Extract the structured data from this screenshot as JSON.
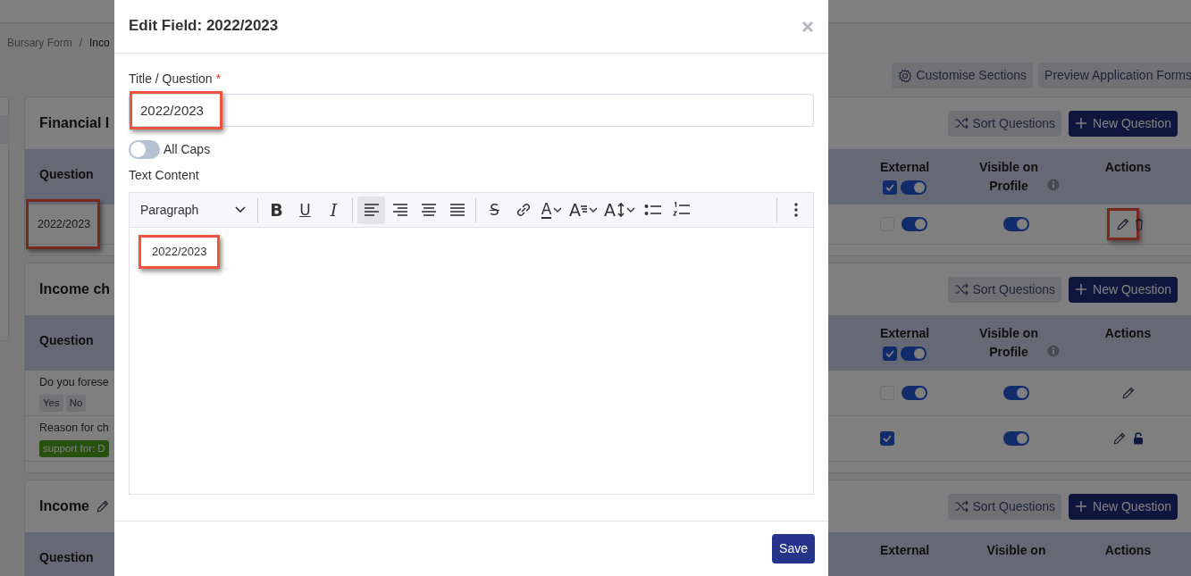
{
  "breadcrumb": {
    "separator": "/",
    "items": [
      {
        "label": "Bursary Form"
      },
      {
        "label": "Inco"
      }
    ]
  },
  "page_actions": [
    {
      "kind": "settings",
      "label": "Customise Sections"
    },
    {
      "kind": "plain",
      "label": "Preview Application Forms"
    }
  ],
  "sections": [
    {
      "title": "Financial I",
      "buttons": [
        {
          "kind": "sort",
          "label": "Sort Questions"
        },
        {
          "kind": "add",
          "label": "New Question"
        }
      ],
      "columns": [
        {
          "label": "Question"
        },
        {
          "label": "External",
          "checked": true,
          "on": true
        },
        {
          "label": "Visible on Profile",
          "info": true
        },
        {
          "label": "Actions"
        }
      ],
      "rows": [
        {
          "question": "2022/2023",
          "highlighted": true,
          "external": {
            "checked": false,
            "on": true
          },
          "visible": {
            "on": true
          },
          "actions": [
            {
              "kind": "edit",
              "highlighted": true
            },
            {
              "kind": "delete"
            }
          ]
        }
      ]
    },
    {
      "title": "Income ch",
      "buttons": [
        {
          "kind": "sort",
          "label": "Sort Questions"
        },
        {
          "kind": "add",
          "label": "New Question"
        }
      ],
      "columns": [
        {
          "label": "Question"
        },
        {
          "label": "External",
          "checked": true,
          "on": true
        },
        {
          "label": "Visible on Profile",
          "info": true
        },
        {
          "label": "Actions"
        }
      ],
      "rows": [
        {
          "question": "Do you forese",
          "badges": [
            {
              "kind": "option",
              "label": "Yes"
            },
            {
              "kind": "option",
              "label": "No"
            }
          ],
          "external": {
            "checked": false,
            "on": true
          },
          "visible": {
            "on": true
          },
          "actions": [
            {
              "kind": "edit"
            }
          ]
        },
        {
          "question": "Reason for ch",
          "badges": [
            {
              "kind": "condition",
              "label": "support for: D"
            }
          ],
          "external": {
            "checked": true
          },
          "visible": {
            "on": true
          },
          "actions": [
            {
              "kind": "edit"
            },
            {
              "kind": "lock"
            }
          ]
        }
      ]
    },
    {
      "title": "Income",
      "editable": true,
      "buttons": [
        {
          "kind": "sort",
          "label": "Sort Questions"
        },
        {
          "kind": "add",
          "label": "New Question"
        }
      ],
      "columns": [
        {
          "label": "Question"
        },
        {
          "label": "External"
        },
        {
          "label": "Visible on"
        },
        {
          "label": "Actions"
        }
      ]
    }
  ],
  "modal": {
    "title": "Edit Field: 2022/2023",
    "title_field": {
      "label": "Title / Question",
      "required_mark": "*",
      "value": "2022/2023",
      "highlighted": true
    },
    "all_caps": {
      "label": "All Caps",
      "on": false
    },
    "editor": {
      "label": "Text Content",
      "toolbar": [
        [
          {
            "kind": "heading",
            "label": "Paragraph"
          }
        ],
        [
          {
            "kind": "bold",
            "label": "B",
            "selected": false
          },
          {
            "kind": "underline",
            "label": "U",
            "selected": false
          },
          {
            "kind": "italic",
            "label": "I",
            "selected": false
          }
        ],
        [
          {
            "kind": "align_left",
            "selected": true
          },
          {
            "kind": "align_right",
            "selected": false
          },
          {
            "kind": "align_center",
            "selected": false
          },
          {
            "kind": "align_justify",
            "selected": false
          }
        ],
        [
          {
            "kind": "strike",
            "label": "S",
            "selected": false
          },
          {
            "kind": "link",
            "selected": false
          },
          {
            "kind": "font_color",
            "label": "A",
            "selected": false
          },
          {
            "kind": "font_size",
            "label": "A",
            "selected": false
          },
          {
            "kind": "line_height",
            "label": "A",
            "selected": false
          },
          {
            "kind": "bullets",
            "selected": false
          },
          {
            "kind": "numbers",
            "selected": false
          }
        ],
        [
          {
            "kind": "more",
            "selected": false
          }
        ]
      ],
      "content": "2022/2023",
      "highlighted": true
    },
    "save": "Save"
  }
}
